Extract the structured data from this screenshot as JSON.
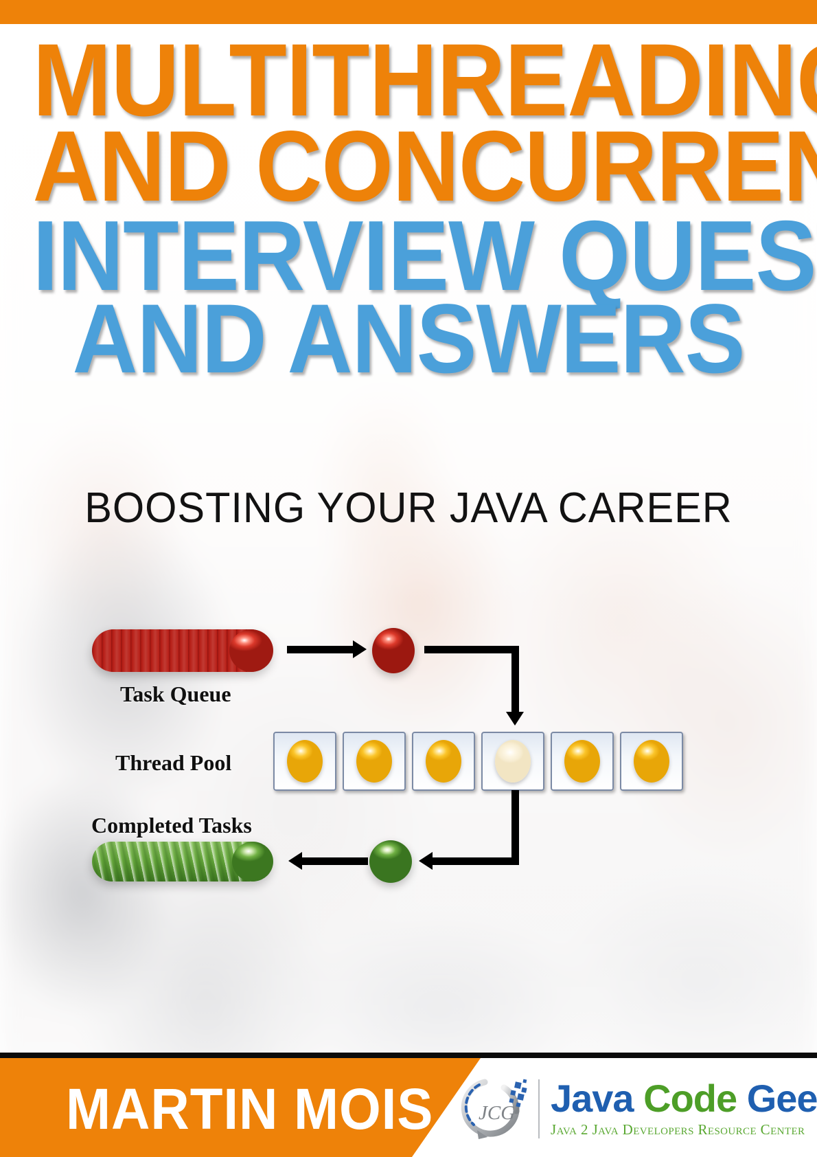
{
  "theme": {
    "orange": "#ee8209",
    "blue": "#4ba0da",
    "logo_blue": "#1f5fb0",
    "logo_green": "#4d9e27",
    "black": "#0b0b0b"
  },
  "title": {
    "line1": "MULTITHREADING",
    "line2": "AND CONCURRENCY",
    "line3": "INTERVIEW QUESTIONS",
    "line4": "AND ANSWERS"
  },
  "subtitle": "BOOSTING YOUR JAVA CAREER",
  "diagram": {
    "labels": {
      "task_queue": "Task Queue",
      "thread_pool": "Thread Pool",
      "completed_tasks": "Completed Tasks"
    },
    "thread_pool": {
      "slot_count": 6,
      "slots": [
        "busy",
        "busy",
        "busy",
        "idle",
        "busy",
        "busy"
      ]
    },
    "queue_color": "#cf2b1e",
    "completed_color": "#66a83c",
    "thread_color": "#fbc52a",
    "flow": [
      "Task Queue",
      "task",
      "Thread Pool",
      "completed task",
      "Completed Tasks"
    ]
  },
  "author": "MARTIN MOIS",
  "logo": {
    "mark_text": "JCG",
    "word1": "Java",
    "word2": "Code",
    "word3": "Geeks",
    "tagline": "Java 2 Java Developers Resource Center"
  }
}
